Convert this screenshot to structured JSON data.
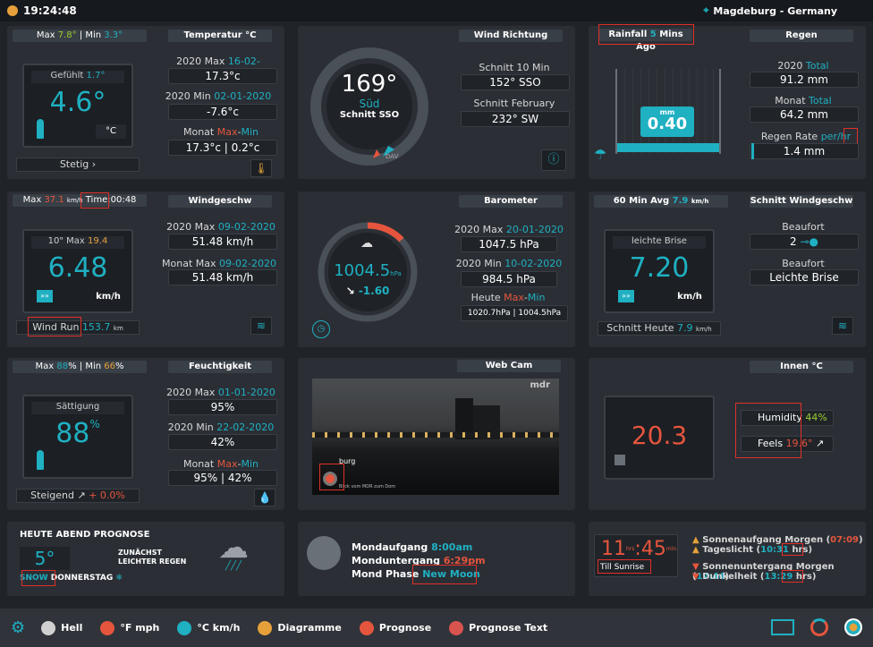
{
  "top": {
    "time": "19:24:48",
    "location": "Magdeburg - Germany"
  },
  "temp": {
    "max_label": "Max",
    "max_value": "7.8°",
    "sep": "| Min",
    "min_value": "3.3°",
    "header": "Temperatur °C",
    "gefuhlt_label": "Gefühlt",
    "gefuhlt_value": "1.7°",
    "value": "4.6°",
    "unit": "°C",
    "trend": "Stetig",
    "y_max_label": "2020 Max",
    "y_max_date": "16-02-2020",
    "y_max_value": "17.3°c",
    "y_min_label": "2020 Min",
    "y_min_date": "02-01-2020",
    "y_min_value": "-7.6°c",
    "month_label": "Monat",
    "month_max": "Max",
    "month_min": "Min",
    "month_value": "17.3°c | 0.2°c"
  },
  "winddir": {
    "header": "Wind Richtung",
    "degrees": "169°",
    "dir": "Süd",
    "avg": "Schnitt SSO",
    "s10_label": "Schnitt 10 Min",
    "s10_value": "152°  SSO",
    "sfeb_label": "Schnitt February",
    "sfeb_value": "232°  SW",
    "dav": "DAV"
  },
  "rain": {
    "rainfall_label": "Rainfall",
    "rainfall_value": "5",
    "rainfall_suffix": "Mins Ago",
    "header": "Regen",
    "unit": "mm",
    "value": "0.40",
    "y_label": "2020",
    "y_total": "Total",
    "y_value": "91.2 mm",
    "m_label": "Monat",
    "m_total": "Total",
    "m_value": "64.2 mm",
    "rate_label": "Regen Rate",
    "rate_unit_a": "per/",
    "rate_unit_b": "hr",
    "rate_value": "1.4 mm"
  },
  "wind": {
    "max_label": "Max",
    "max_value": "37.1",
    "max_unit": "km/h",
    "time_label": "Time:",
    "time_value": "00:48",
    "header": "Windgeschw",
    "tenmax_label": "10\" Max",
    "tenmax_value": "19.4",
    "value": "6.48",
    "unit": "km/h",
    "run_label": "Wind Run",
    "run_value": "153.7",
    "run_unit": "km",
    "y_max_label": "2020 Max",
    "y_max_date": "09-02-2020",
    "y_max_value": "51.48 km/h",
    "m_max_label": "Monat Max",
    "m_max_date": "09-02-2020",
    "m_max_value": "51.48 km/h"
  },
  "baro": {
    "header": "Barometer",
    "value": "1004.5",
    "unit": "hPa",
    "trend": "-1.60",
    "y_max_label": "2020 Max",
    "y_max_date": "20-01-2020",
    "y_max_value": "1047.5 hPa",
    "y_min_label": "2020 Min",
    "y_min_date": "10-02-2020",
    "y_min_value": "984.5 hPa",
    "today_label": "Heute",
    "today_max": "Max",
    "today_min": "Min",
    "today_a": "1020.7hPa",
    "today_b": "1004.5hPa"
  },
  "avgwind": {
    "avg_label": "60 Min Avg",
    "avg_value": "7.9",
    "avg_unit": "km/h",
    "header": "Schnitt Windgeschw",
    "desc": "leichte Brise",
    "value": "7.20",
    "unit": "km/h",
    "today_label": "Schnitt Heute",
    "today_value": "7.9",
    "today_unit": "km/h",
    "beaufort_label": "Beaufort",
    "beaufort_value": "2",
    "beaufort_label2": "Beaufort",
    "beaufort_desc": "Leichte Brise"
  },
  "hum": {
    "max_label": "Max",
    "max_value": "88",
    "min_label": "| Min",
    "min_value": "66",
    "header": "Feuchtigkeit",
    "sat_label": "Sättigung",
    "value": "88",
    "unit": "%",
    "trend_label": "Steigend",
    "trend_value": "+ 0.0%",
    "y_max_label": "2020 Max",
    "y_max_date": "01-01-2020",
    "y_max_value": "95%",
    "y_min_label": "2020 Min",
    "y_min_date": "22-02-2020",
    "y_min_value": "42%",
    "month_label": "Monat",
    "month_max": "Max",
    "month_min": "Min",
    "month_value": "95% | 42%"
  },
  "webcam": {
    "header": "Web Cam",
    "logo": "mdr",
    "caption": "burg",
    "subcaption": "Blick vom MDR zum Dom"
  },
  "indoor": {
    "header": "Innen °C",
    "value": "20.3",
    "humidity_label": "Humidity",
    "humidity_value": "44%",
    "feels_label": "Feels",
    "feels_value": "19.6°"
  },
  "forecast": {
    "title": "HEUTE ABEND PROGNOSE",
    "temp": "5°",
    "line1": "ZUNÄCHST",
    "line2": "LEICHTER REGEN",
    "snow": "SNOW",
    "day": "DONNERSTAG"
  },
  "moon": {
    "rise_label": "Mondaufgang",
    "rise_value": "8:00am",
    "set_label": "Monduntergang",
    "set_value": "6:29pm",
    "phase_label": "Mond Phase",
    "phase_value": "New Moon"
  },
  "sun": {
    "hours": "11",
    "hrs": "hrs",
    "mins": "45",
    "min": "min",
    "till": "Till Sunrise",
    "rise_label": "Sonnenaufgang Morgen",
    "rise_value": "07:09",
    "day_label": "Tageslicht",
    "day_value": "10:31",
    "day_unit": "hrs",
    "set_label": "Sonnenuntergang Morgen",
    "set_value": "17:44",
    "dark_label": "Dunkelheit",
    "dark_value": "13:29",
    "dark_unit": "hrs"
  },
  "bottom": {
    "items": [
      {
        "label": "Hell",
        "color": "#d0d0d0"
      },
      {
        "label": "°F mph",
        "color": "#e5553d"
      },
      {
        "label": "°C km/h",
        "color": "#1fb0c2"
      },
      {
        "label": "Diagramme",
        "color": "#e5a03a"
      },
      {
        "label": "Prognose",
        "color": "#e5553d"
      },
      {
        "label": "Prognose Text",
        "color": "#d9534f"
      }
    ]
  }
}
